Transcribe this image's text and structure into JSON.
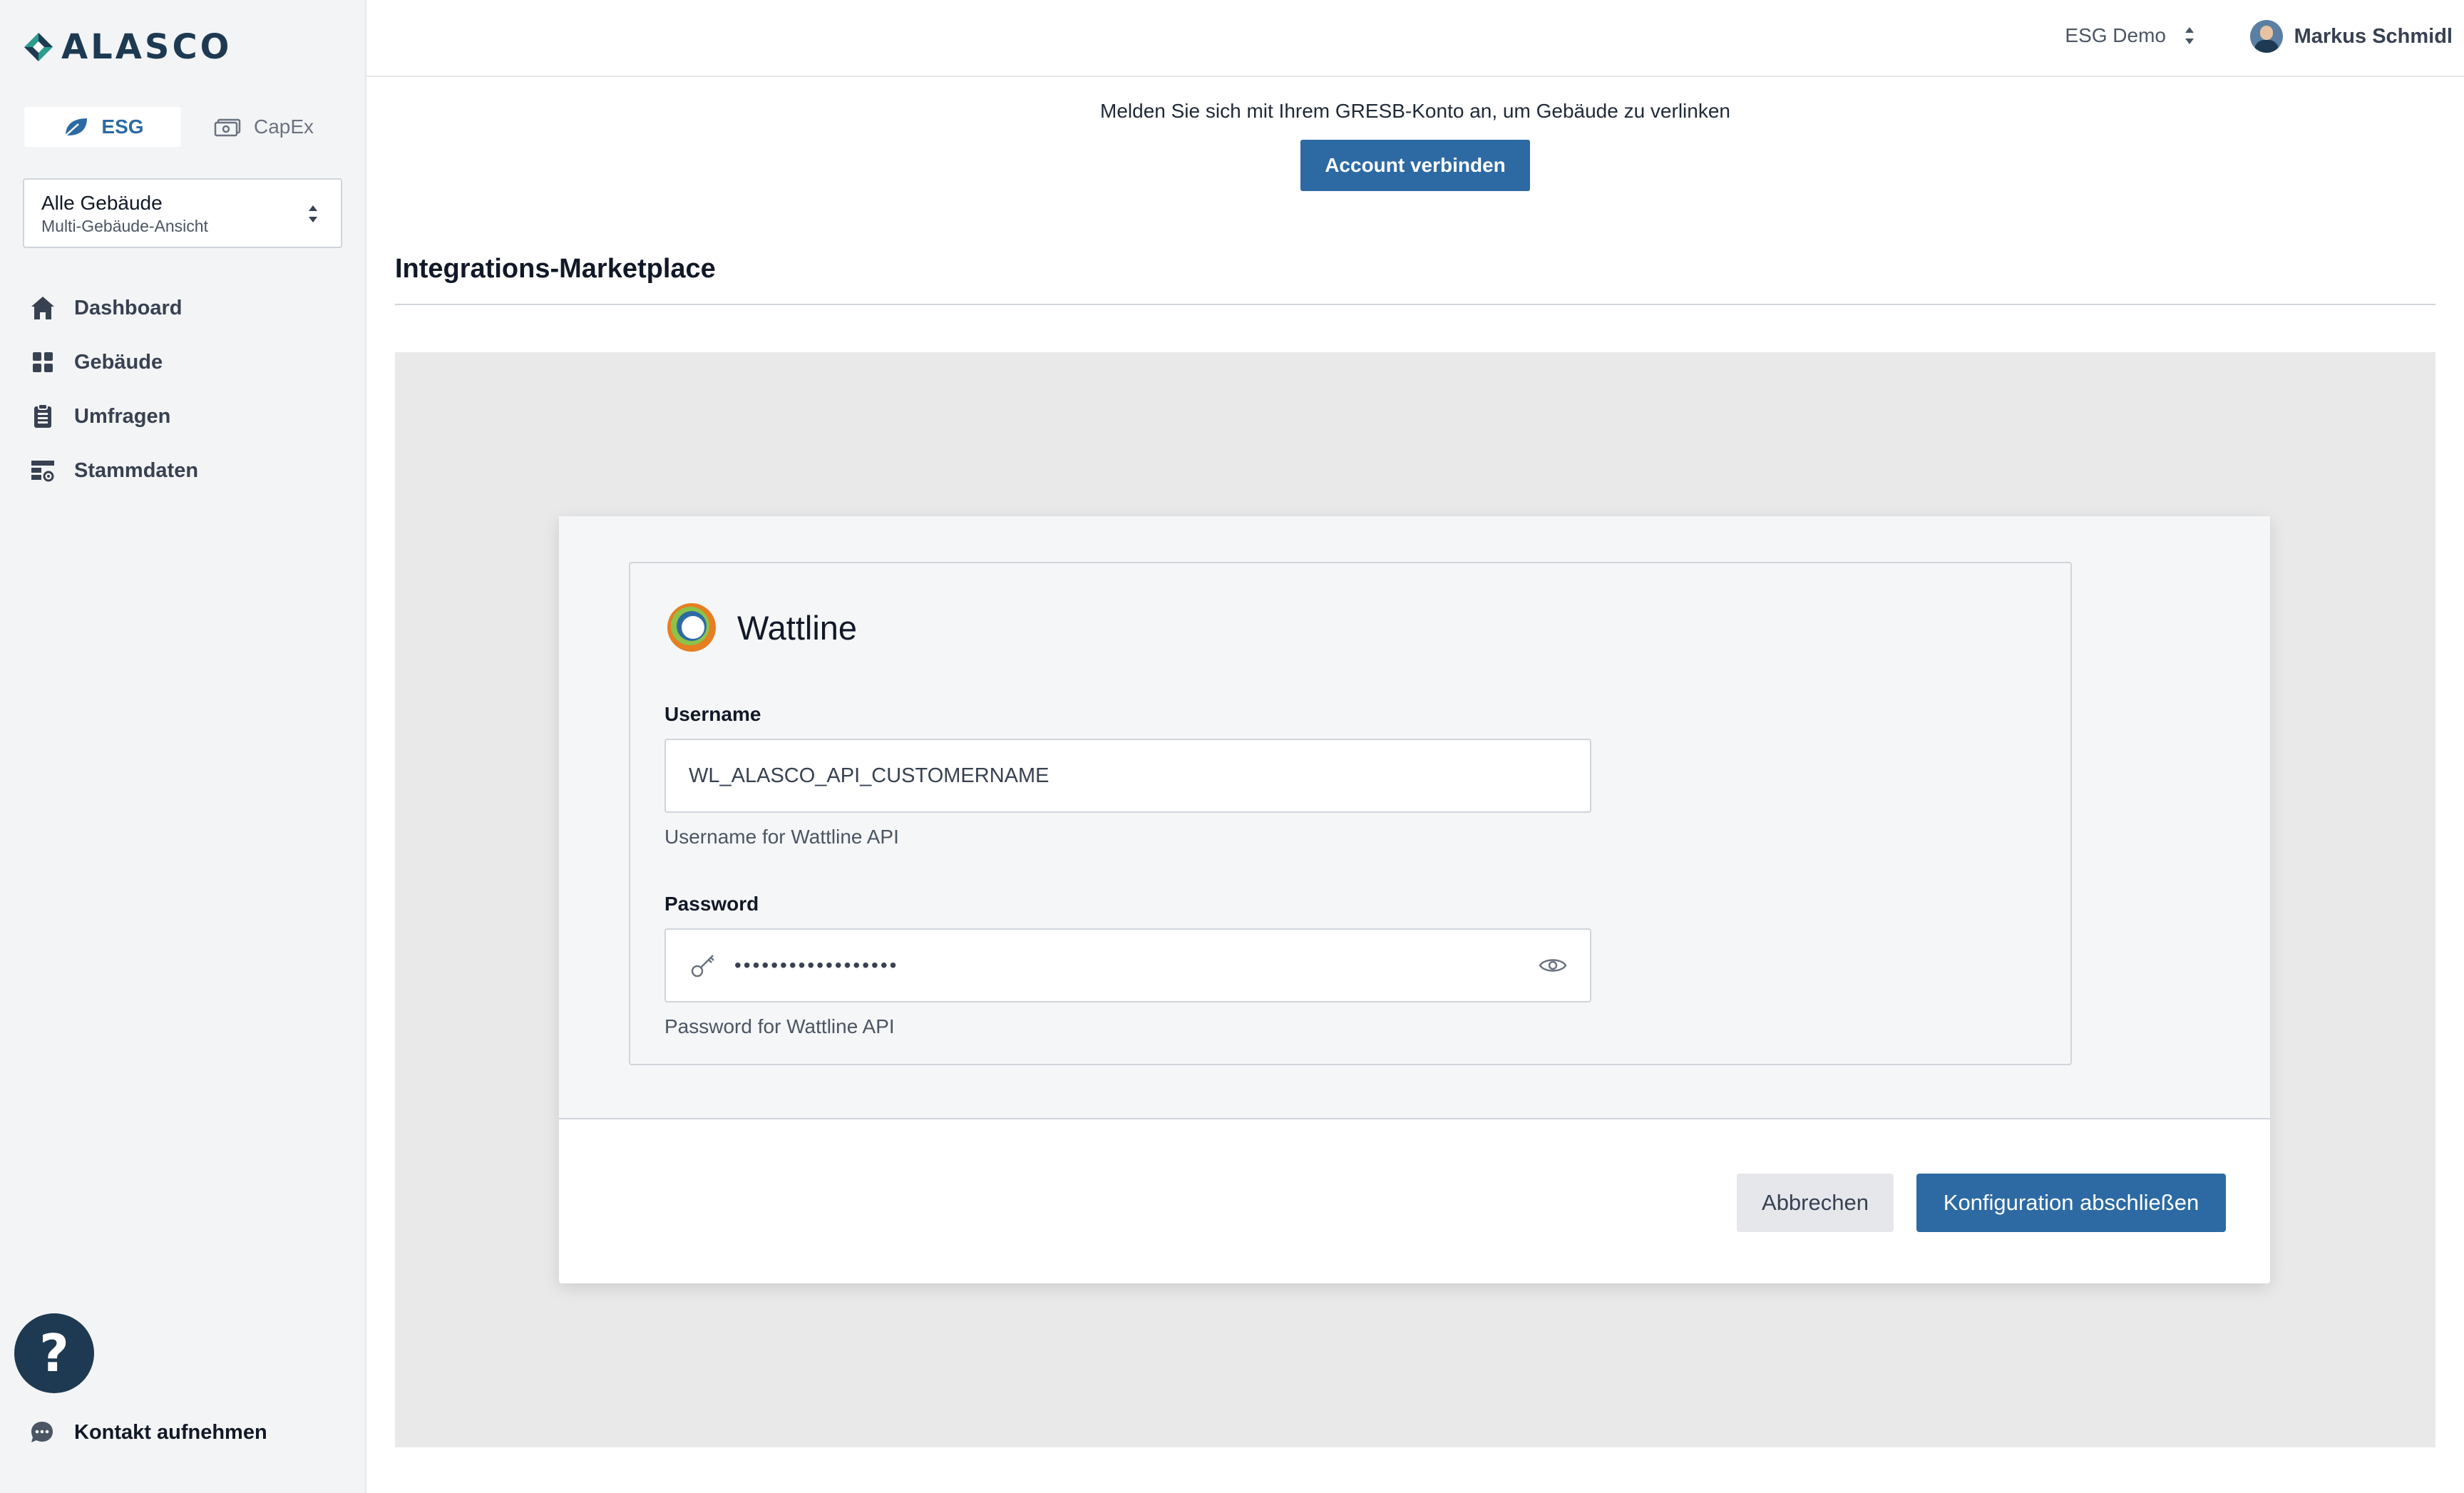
{
  "brand": {
    "name": "ALASCO"
  },
  "modules": {
    "esg": "ESG",
    "capex": "CapEx"
  },
  "building_selector": {
    "title": "Alle Gebäude",
    "subtitle": "Multi-Gebäude-Ansicht"
  },
  "nav": {
    "items": [
      {
        "label": "Dashboard",
        "icon": "home-icon"
      },
      {
        "label": "Gebäude",
        "icon": "grid-icon"
      },
      {
        "label": "Umfragen",
        "icon": "clipboard-icon"
      },
      {
        "label": "Stammdaten",
        "icon": "table-settings-icon"
      }
    ]
  },
  "help": {
    "symbol": "?"
  },
  "contact": {
    "label": "Kontakt aufnehmen"
  },
  "topbar": {
    "workspace": "ESG Demo",
    "user_name": "Markus Schmidl"
  },
  "gresb": {
    "notice": "Melden Sie sich mit Ihrem GRESB-Konto an, um Gebäude zu verlinken",
    "button": "Account verbinden"
  },
  "section": {
    "title": "Integrations-Marketplace"
  },
  "modal": {
    "provider": "Wattline",
    "username": {
      "label": "Username",
      "value": "WL_ALASCO_API_CUSTOMERNAME",
      "help": "Username for Wattline API"
    },
    "password": {
      "label": "Password",
      "value": "••••••••••••••••••",
      "help": "Password for Wattline API"
    },
    "cancel": "Abbrechen",
    "submit": "Konfiguration abschließen"
  },
  "colors": {
    "accent": "#2d6aa3",
    "brand_dark": "#1e3a52",
    "sidebar_bg": "#f3f4f6",
    "overlay": "#e9e9ea"
  }
}
